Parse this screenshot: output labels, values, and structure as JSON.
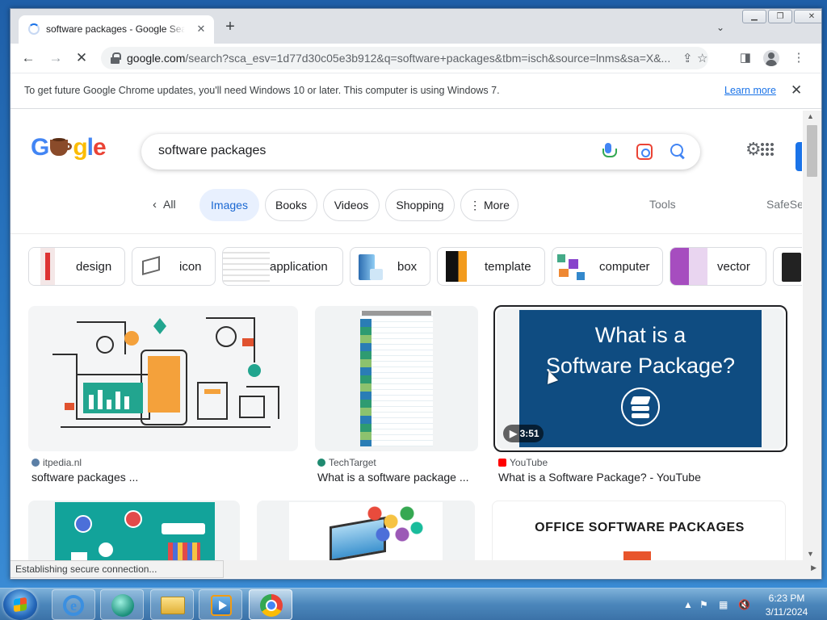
{
  "browser": {
    "tab_title": "software packages - Google Search",
    "url_domain": "google.com",
    "url_rest": "/search?sca_esv=1d77d30c05e3b912&q=software+packages&tbm=isch&source=lnms&sa=X&...",
    "infobar_text": "To get future Google Chrome updates, you'll need Windows 10 or later. This computer is using Windows 7.",
    "infobar_link": "Learn more",
    "status_text": "Establishing secure connection..."
  },
  "search": {
    "query": "software packages",
    "tabs": {
      "all": "All",
      "images": "Images",
      "books": "Books",
      "videos": "Videos",
      "shopping": "Shopping",
      "more": "More",
      "tools": "Tools",
      "safesearch": "SafeSe"
    }
  },
  "related": [
    "design",
    "icon",
    "application",
    "box",
    "template",
    "computer",
    "vector"
  ],
  "results": [
    {
      "source": "itpedia.nl",
      "title": "software packages ..."
    },
    {
      "source": "TechTarget",
      "title": "What is a software package ..."
    },
    {
      "source": "YouTube",
      "title": "What is a Software Package? - YouTube",
      "thumb_line1": "What is a",
      "thumb_line2": "Software Package?",
      "duration": "3:51"
    }
  ],
  "row2": {
    "office_title": "OFFICE SOFTWARE PACKAGES"
  },
  "colors": {
    "accent": "#1a73e8",
    "youtube_blue": "#0f4c81",
    "teal": "#12a39a"
  },
  "clock": {
    "time": "6:23 PM",
    "date": "3/11/2024"
  }
}
